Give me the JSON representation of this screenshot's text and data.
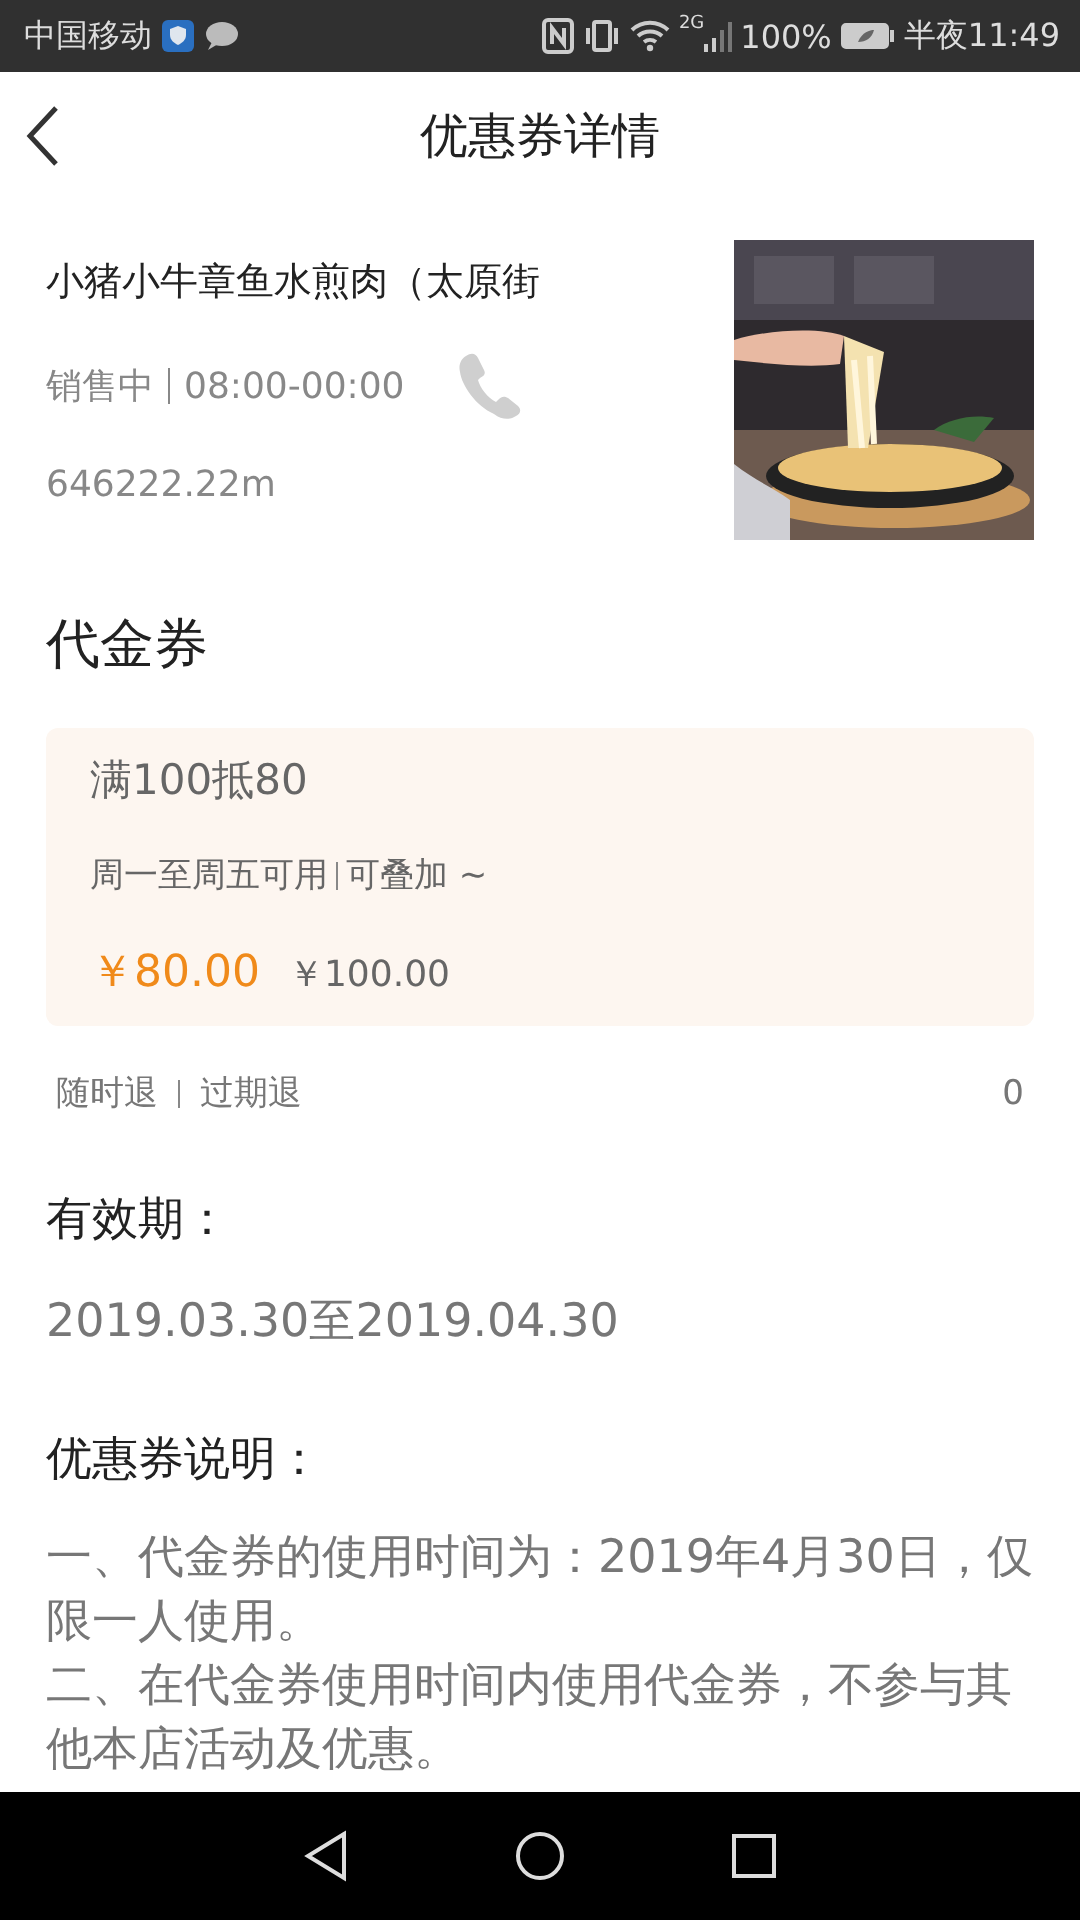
{
  "status_bar": {
    "carrier": "中国移动",
    "network": "2G",
    "battery": "100%",
    "time": "半夜11:49"
  },
  "header": {
    "title": "优惠券详情"
  },
  "shop": {
    "name": "小猪小牛章鱼水煎肉（太原街",
    "status": "销售中",
    "hours": "08:00-00:00",
    "distance": "646222.22m"
  },
  "coupon_section": {
    "title": "代金券",
    "coupon": {
      "title": "满100抵80",
      "rules": "周一至周五可用",
      "stackable": "可叠加 ~",
      "price": "￥80.00",
      "original_price": "￥100.00"
    }
  },
  "refund": {
    "tags": [
      "随时退",
      "过期退"
    ],
    "count": "0"
  },
  "validity": {
    "title": "有效期：",
    "value": "2019.03.30至2019.04.30"
  },
  "description": {
    "title": "优惠券说明：",
    "paragraphs": [
      "一、代金券的使用时间为：2019年4月30日，仅限一人使用。",
      "二、在代金券使用时间内使用代金券，不参与其他本店活动及优惠。"
    ]
  }
}
